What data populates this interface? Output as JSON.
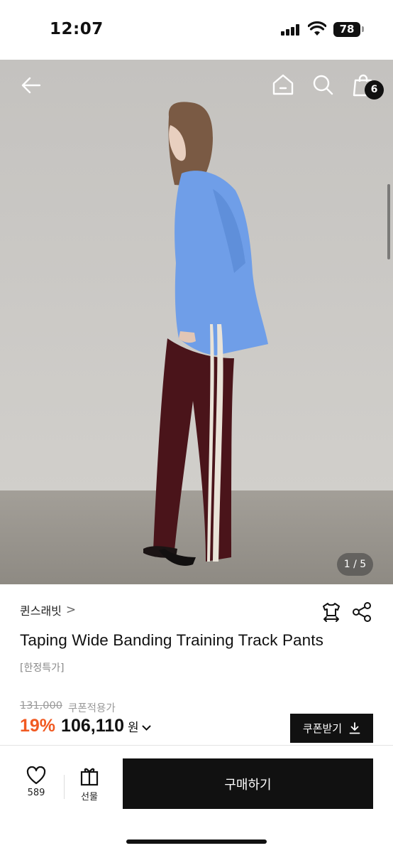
{
  "status_bar": {
    "time": "12:07",
    "battery": "78"
  },
  "header": {
    "back_icon": "arrow-left-icon",
    "home_icon": "home-icon",
    "search_icon": "search-icon",
    "cart_icon": "shopping-bag-icon",
    "cart_count": "6"
  },
  "gallery": {
    "counter": "1 / 5",
    "current": 1,
    "total": 5
  },
  "product": {
    "brand": "퀸스래빗",
    "brand_chevron": ">",
    "title": "Taping Wide Banding Training Track Pants",
    "tag": "[한정특가]",
    "original_price": "131,000",
    "coupon_note": "쿠폰적용가",
    "discount": "19%",
    "price": "106,110",
    "currency": "원",
    "price_chevron": "⌄"
  },
  "actions": {
    "size_icon": "tshirt-size-icon",
    "share_icon": "share-icon",
    "coupon_label": "쿠폰받기",
    "coupon_icon": "download-icon"
  },
  "bottom_bar": {
    "like_count": "589",
    "gift_label": "선물",
    "buy_label": "구매하기"
  },
  "colors": {
    "accent_discount": "#f15a22",
    "primary_button": "#111111"
  }
}
